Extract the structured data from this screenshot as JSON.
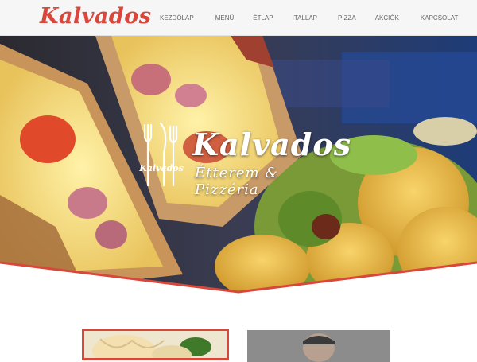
{
  "header": {
    "logo": "Kalvados",
    "nav": [
      {
        "label": "KEZDŐLAP"
      },
      {
        "label": "MENÜ"
      },
      {
        "label": "ÉTLAP"
      },
      {
        "label": "ITALLAP"
      },
      {
        "label": "PIZZA"
      },
      {
        "label": "AKCIÓK"
      },
      {
        "label": "KAPCSOLAT"
      }
    ]
  },
  "hero": {
    "title": "Kalvados",
    "subtitle": "Étterem & Pizzéria",
    "emblem_text": "Kalvados"
  },
  "colors": {
    "accent": "#d9473b",
    "nav_bg": "#f6f6f6",
    "nav_text": "#666666"
  }
}
